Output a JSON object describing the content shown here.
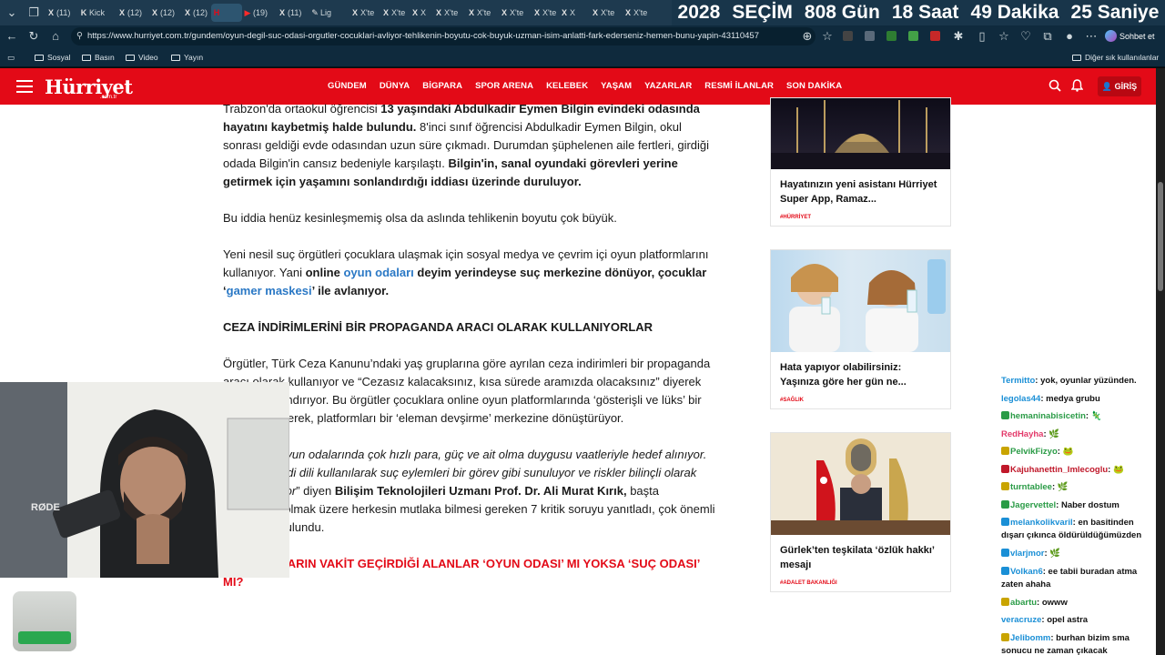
{
  "tabs": [
    {
      "icon": "X",
      "label": "(11)"
    },
    {
      "icon": "K",
      "label": "Kick"
    },
    {
      "icon": "X",
      "label": "(12)"
    },
    {
      "icon": "X",
      "label": "(12)"
    },
    {
      "icon": "X",
      "label": "(12)"
    },
    {
      "icon": "H",
      "label": ""
    },
    {
      "icon": "▶",
      "label": "(19)"
    },
    {
      "icon": "X",
      "label": "(11)"
    },
    {
      "icon": "✎",
      "label": "Lig"
    },
    {
      "icon": "X",
      "label": "X'te"
    },
    {
      "icon": "X",
      "label": "X'te"
    },
    {
      "icon": "X",
      "label": "X"
    },
    {
      "icon": "X",
      "label": "X'te"
    },
    {
      "icon": "X",
      "label": "X'te"
    },
    {
      "icon": "X",
      "label": "X'te"
    },
    {
      "icon": "X",
      "label": "X'te"
    },
    {
      "icon": "X",
      "label": "X"
    },
    {
      "icon": "X",
      "label": "X'te"
    },
    {
      "icon": "X",
      "label": "X'te"
    }
  ],
  "countdown": {
    "year": "2028",
    "event": "SEÇİM",
    "days": "808 Gün",
    "hours": "18 Saat",
    "minutes": "49 Dakika",
    "seconds": "25 Saniye"
  },
  "address": {
    "url": "https://www.hurriyet.com.tr/gundem/oyun-degil-suc-odasi-orgutler-cocuklari-avliyor-tehlikenin-boyutu-cok-buyuk-uzman-isim-anlatti-fark-ederseniz-hemen-bunu-yapin-43110457",
    "chat_label": "Sohbet et"
  },
  "bookmarks": {
    "items": [
      "Sosyal",
      "Basın",
      "Video",
      "Yayın"
    ],
    "other": "Diğer sık kullanılanlar"
  },
  "site": {
    "logo": "Hürriyet",
    "logo_sub": ".com.tr",
    "menu": [
      "GÜNDEM",
      "DÜNYA",
      "BİGPARA",
      "SPOR ARENA",
      "KELEBEK",
      "YAŞAM",
      "YAZARLAR",
      "RESMİ İLANLAR",
      "SON DAKİKA"
    ],
    "login": "GİRİŞ"
  },
  "article": {
    "p1a": "Trabzon'da ortaokul öğrencisi ",
    "p1b": "13 yaşındaki Abdulkadir Eymen Bilgin evindeki odasında hayatını kaybetmiş halde bulundu.",
    "p1c": " 8'inci sınıf öğrencisi Abdulkadir Eymen Bilgin, okul sonrası geldiği evde odasından uzun süre çıkmadı. Durumdan şüphelenen aile fertleri, girdiği odada Bilgin'in cansız bedeniyle karşılaştı. ",
    "p1d": "Bilgin'in, sanal oyundaki görevleri yerine getirmek için yaşamını sonlandırdığı iddiası üzerinde duruluyor.",
    "p2": "Bu iddia henüz kesinleşmemiş olsa da aslında tehlikenin boyutu çok büyük.",
    "p3a": "Yeni nesil suç örgütleri çocuklara ulaşmak için sosyal medya ve çevrim içi oyun platformlarını kullanıyor. Yani ",
    "p3b": "online ",
    "p3c": "oyun odaları",
    "p3d": " deyim yerindeyse suç merkezine dönüyor, çocuklar ‘",
    "p3e": "gamer maskesi",
    "p3f": "’ ile avlanıyor.",
    "h1": "CEZA İNDİRİMLERİNİ BİR PROPAGANDA ARACI OLARAK KULLANIYORLAR",
    "p4": "Örgütler, Türk Ceza Kanunu’ndaki yaş gruplarına göre ayrılan ceza indirimleri bir propaganda aracı olarak kullanıyor ve “Cezasız kalacaksınız, kısa sürede aramızda olacaksınız” diyerek çocukları kandırıyor. Bu örgütler çocuklara online oyun platformlarında ‘gösterişli ve lüks’ bir hayat vadederek, platformları bir ‘eleman devşirme’ merkezine dönüştürüyor.",
    "p5a": "“Çocuklar, oyun odalarında çok hızlı para, güç ve ait olma duygusu vaatleriyle hedef alınıyor. Oyunun kendi dili kullanılarak suç eylemleri bir görev gibi sunuluyor ve riskler bilinçli olarak küçümseniyor",
    "p5b": "” diyen ",
    "p5c": "Bilişim Teknolojileri Uzmanı Prof. Dr. Ali Murat Kırık,",
    "p5d": " başta ebeveynler olmak üzere herkesin mutlaka bilmesi gereken 7 kritik soruyu yanıtladı, çok önemli uyarılarda bulundu.",
    "h2": "1- ÇOCUKLARIN VAKİT GEÇİRDİĞİ ALANLAR ‘OYUN ODASI’ MI YOKSA ‘SUÇ ODASI’ MI?"
  },
  "cards": [
    {
      "title": "Hayatınızın yeni asistanı Hürriyet Super App, Ramaz...",
      "tag": "#HÜRRİYET"
    },
    {
      "title": "Hata yapıyor olabilirsiniz: Yaşınıza göre her gün ne...",
      "tag": "#SAĞLIK"
    },
    {
      "title": "Gürlek’ten teşkilata ‘özlük hakkı’ mesajı",
      "tag": "#ADALET BAKANLIĞI"
    }
  ],
  "chat": [
    {
      "user": "Termitto",
      "color": "#1a8fd6",
      "msg": "yok, oyunlar yüzünden.",
      "badge": ""
    },
    {
      "user": "legolas44",
      "color": "#1a8fd6",
      "msg": "medya grubu",
      "badge": ""
    },
    {
      "user": "hemaninabisicetin",
      "color": "#2a9b46",
      "msg": "🦎",
      "badge": "#2a9b46"
    },
    {
      "user": "RedHayha",
      "color": "#e33a6a",
      "msg": "🌿",
      "badge": ""
    },
    {
      "user": "PelvikFizyo",
      "color": "#2a9b46",
      "msg": "🐸",
      "badge": "#c9a400"
    },
    {
      "user": "Kajuhanettin_Imlecoglu",
      "color": "#c0182a",
      "msg": "🐸",
      "badge": "#c0182a"
    },
    {
      "user": "turntablee",
      "color": "#2a9b46",
      "msg": "🌿",
      "badge": "#c9a400"
    },
    {
      "user": "Jagervettel",
      "color": "#2a9b46",
      "msg": "Naber dostum",
      "badge": "#2a9b46"
    },
    {
      "user": "melankolikvaril",
      "color": "#1a8fd6",
      "msg": "en basitinden dışarı çıkınca öldürüldüğümüzden",
      "badge": "#1a8fd6"
    },
    {
      "user": "vlarjmor",
      "color": "#1a8fd6",
      "msg": "🌿",
      "badge": "#1a8fd6"
    },
    {
      "user": "Volkan6",
      "color": "#1a8fd6",
      "msg": "ee tabii buradan atma zaten ahaha",
      "badge": "#1a8fd6"
    },
    {
      "user": "abartu",
      "color": "#2a9b46",
      "msg": "owww",
      "badge": "#c9a400"
    },
    {
      "user": "veracruze",
      "color": "#1a8fd6",
      "msg": "opel astra",
      "badge": ""
    },
    {
      "user": "Jelibomm",
      "color": "#1a8fd6",
      "msg": "burhan bizim sma sonucu ne zaman çıkacak",
      "badge": "#c9a400"
    }
  ],
  "webcam": {
    "mic_label": "RØDE"
  }
}
